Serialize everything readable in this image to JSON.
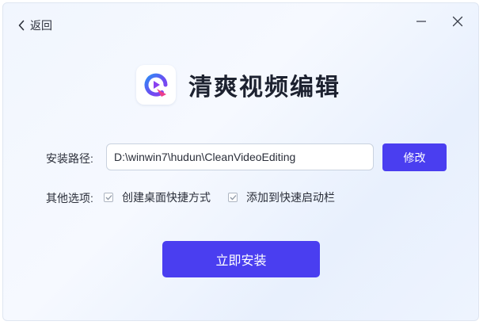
{
  "header": {
    "back_label": "返回",
    "back_icon": "chevron-left-icon",
    "minimize_icon": "minimize-icon",
    "close_icon": "close-icon"
  },
  "app": {
    "name": "清爽视频编辑",
    "logo_icon": "app-logo-icon"
  },
  "install_path": {
    "label": "安装路径:",
    "value": "D:\\winwin7\\hudun\\CleanVideoEditing",
    "modify_label": "修改"
  },
  "options": {
    "label": "其他选项:",
    "items": [
      {
        "label": "创建桌面快捷方式",
        "checked": true
      },
      {
        "label": "添加到快速启动栏",
        "checked": true
      }
    ]
  },
  "install_button": {
    "label": "立即安装"
  },
  "colors": {
    "accent": "#4a3ef0",
    "text": "#2b2f3a",
    "logo_blue": "#2e8cf5",
    "logo_purple": "#8a3ff0",
    "logo_pink": "#ec3f8a"
  }
}
